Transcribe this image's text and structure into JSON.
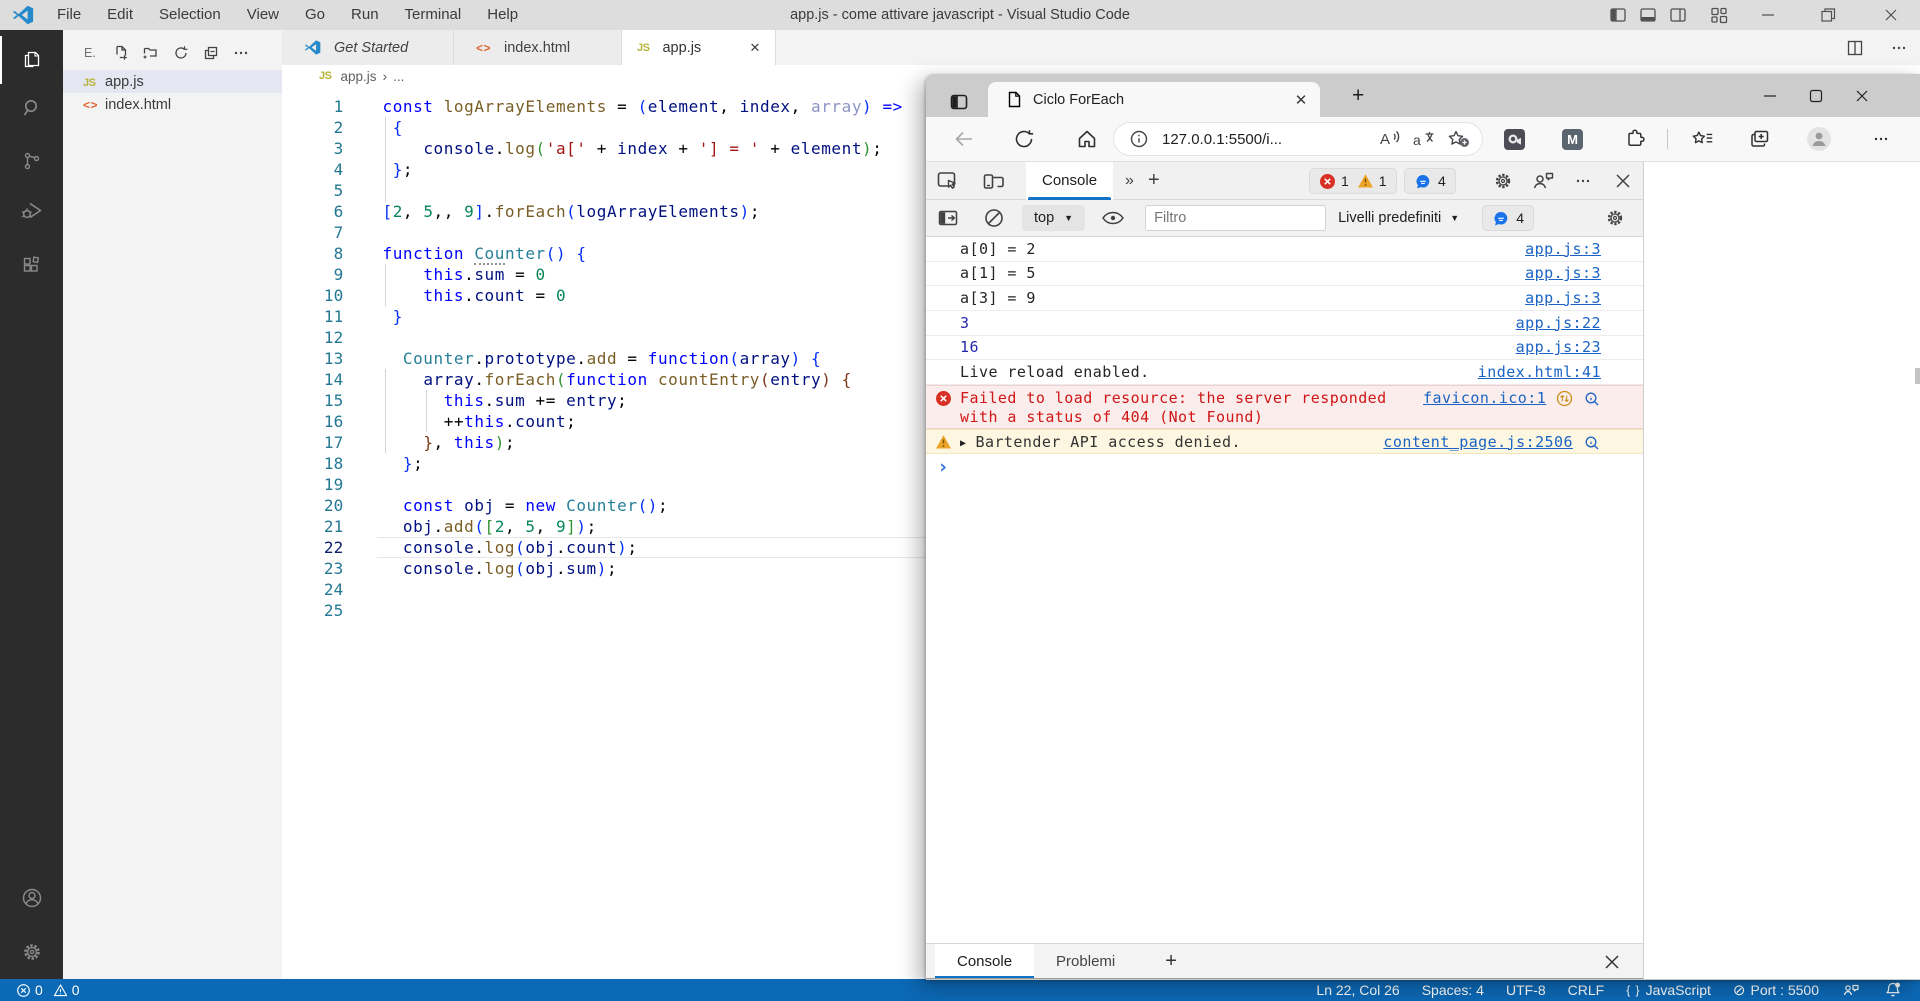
{
  "colors": {
    "vscode_statusbar": "#0c69b6",
    "vscode_activitybar": "#2c2c2c",
    "accent_blue": "#1173c5",
    "error_red": "#d01616",
    "warning_amber": "#eea329",
    "link_blue": "#1a63c5"
  },
  "vscode": {
    "window_title": "app.js - come attivare javascript - Visual Studio Code",
    "menus": [
      "File",
      "Edit",
      "Selection",
      "View",
      "Go",
      "Run",
      "Terminal",
      "Help"
    ],
    "explorer": {
      "header": "E.",
      "files": [
        {
          "name": "app.js",
          "icon": "js",
          "selected": true
        },
        {
          "name": "index.html",
          "icon": "html",
          "selected": false
        }
      ]
    },
    "tabs": [
      {
        "label": "Get Started",
        "icon": "vscode",
        "italic": true,
        "active": false,
        "close": false
      },
      {
        "label": "index.html",
        "icon": "html",
        "italic": false,
        "active": false,
        "close": false
      },
      {
        "label": "app.js",
        "icon": "js",
        "italic": false,
        "active": true,
        "close": true
      }
    ],
    "breadcrumb": {
      "file": "app.js",
      "separator": "›",
      "more": "..."
    },
    "code": {
      "current_line": 22,
      "lines": [
        [
          [
            "kw",
            "const"
          ],
          [
            "pl",
            " "
          ],
          [
            "fn",
            "logArrayElements"
          ],
          [
            "pl",
            " = "
          ],
          [
            "b1",
            "("
          ],
          [
            "vr",
            "element"
          ],
          [
            "pl",
            ", "
          ],
          [
            "vr",
            "index"
          ],
          [
            "pl",
            ", "
          ],
          [
            "fade",
            "array"
          ],
          [
            "b1",
            ")"
          ],
          [
            "pl",
            " "
          ],
          [
            "kw",
            "=>"
          ]
        ],
        [
          [
            "pl",
            " "
          ],
          [
            "b1",
            "{"
          ]
        ],
        [
          [
            "pl",
            "    "
          ],
          [
            "vr",
            "console"
          ],
          [
            "pl",
            "."
          ],
          [
            "fn",
            "log"
          ],
          [
            "b2",
            "("
          ],
          [
            "st",
            "'a['"
          ],
          [
            "pl",
            " + "
          ],
          [
            "vr",
            "index"
          ],
          [
            "pl",
            " + "
          ],
          [
            "st",
            "'] = '"
          ],
          [
            "pl",
            " + "
          ],
          [
            "vr",
            "element"
          ],
          [
            "b2",
            ")"
          ],
          [
            "pl",
            ";"
          ]
        ],
        [
          [
            "pl",
            " "
          ],
          [
            "b1",
            "}"
          ],
          [
            "pl",
            ";"
          ]
        ],
        [],
        [
          [
            "b1",
            "["
          ],
          [
            "nu",
            "2"
          ],
          [
            "pl",
            ", "
          ],
          [
            "nu",
            "5"
          ],
          [
            "pl",
            ",, "
          ],
          [
            "nu",
            "9"
          ],
          [
            "b1",
            "]"
          ],
          [
            "pl",
            "."
          ],
          [
            "fn",
            "forEach"
          ],
          [
            "b1",
            "("
          ],
          [
            "vr",
            "logArrayElements"
          ],
          [
            "b1",
            ")"
          ],
          [
            "pl",
            ";"
          ]
        ],
        [],
        [
          [
            "kw",
            "function"
          ],
          [
            "pl",
            " "
          ],
          [
            "clsh",
            "Cou"
          ],
          [
            "cls",
            "nter"
          ],
          [
            "b1",
            "()"
          ],
          [
            "pl",
            " "
          ],
          [
            "b1",
            "{"
          ]
        ],
        [
          [
            "pl",
            "    "
          ],
          [
            "kw",
            "this"
          ],
          [
            "pl",
            "."
          ],
          [
            "vr",
            "sum"
          ],
          [
            "pl",
            " = "
          ],
          [
            "nu",
            "0"
          ]
        ],
        [
          [
            "pl",
            "    "
          ],
          [
            "kw",
            "this"
          ],
          [
            "pl",
            "."
          ],
          [
            "vr",
            "count"
          ],
          [
            "pl",
            " = "
          ],
          [
            "nu",
            "0"
          ]
        ],
        [
          [
            "pl",
            " "
          ],
          [
            "b1",
            "}"
          ]
        ],
        [],
        [
          [
            "pl",
            "  "
          ],
          [
            "cls",
            "Counter"
          ],
          [
            "pl",
            "."
          ],
          [
            "vr",
            "prototype"
          ],
          [
            "pl",
            "."
          ],
          [
            "fn",
            "add"
          ],
          [
            "pl",
            " = "
          ],
          [
            "kw",
            "function"
          ],
          [
            "b1",
            "("
          ],
          [
            "vr",
            "array"
          ],
          [
            "b1",
            ")"
          ],
          [
            "pl",
            " "
          ],
          [
            "b1",
            "{"
          ]
        ],
        [
          [
            "pl",
            "    "
          ],
          [
            "vr",
            "array"
          ],
          [
            "pl",
            "."
          ],
          [
            "fn",
            "forEach"
          ],
          [
            "b2",
            "("
          ],
          [
            "kw",
            "function"
          ],
          [
            "pl",
            " "
          ],
          [
            "fn",
            "countEntry"
          ],
          [
            "b3",
            "("
          ],
          [
            "vr",
            "entry"
          ],
          [
            "b3",
            ")"
          ],
          [
            "pl",
            " "
          ],
          [
            "b3",
            "{"
          ]
        ],
        [
          [
            "pl",
            "      "
          ],
          [
            "kw",
            "this"
          ],
          [
            "pl",
            "."
          ],
          [
            "vr",
            "sum"
          ],
          [
            "pl",
            " += "
          ],
          [
            "vr",
            "entry"
          ],
          [
            "pl",
            ";"
          ]
        ],
        [
          [
            "pl",
            "      ++"
          ],
          [
            "kw",
            "this"
          ],
          [
            "pl",
            "."
          ],
          [
            "vr",
            "count"
          ],
          [
            "pl",
            ";"
          ]
        ],
        [
          [
            "pl",
            "    "
          ],
          [
            "b3",
            "}"
          ],
          [
            "pl",
            ", "
          ],
          [
            "kw",
            "this"
          ],
          [
            "b2",
            ")"
          ],
          [
            "pl",
            ";"
          ]
        ],
        [
          [
            "pl",
            "  "
          ],
          [
            "b1",
            "}"
          ],
          [
            "pl",
            ";"
          ]
        ],
        [],
        [
          [
            "pl",
            "  "
          ],
          [
            "kw",
            "const"
          ],
          [
            "pl",
            " "
          ],
          [
            "vr",
            "obj"
          ],
          [
            "pl",
            " = "
          ],
          [
            "kw",
            "new"
          ],
          [
            "pl",
            " "
          ],
          [
            "cls",
            "Counter"
          ],
          [
            "b1",
            "()"
          ],
          [
            "pl",
            ";"
          ]
        ],
        [
          [
            "pl",
            "  "
          ],
          [
            "vr",
            "obj"
          ],
          [
            "pl",
            "."
          ],
          [
            "fn",
            "add"
          ],
          [
            "b1",
            "("
          ],
          [
            "b2",
            "["
          ],
          [
            "nu",
            "2"
          ],
          [
            "pl",
            ", "
          ],
          [
            "nu",
            "5"
          ],
          [
            "pl",
            ", "
          ],
          [
            "nu",
            "9"
          ],
          [
            "b2",
            "]"
          ],
          [
            "b1",
            ")"
          ],
          [
            "pl",
            ";"
          ]
        ],
        [
          [
            "pl",
            "  "
          ],
          [
            "vr",
            "console"
          ],
          [
            "pl",
            "."
          ],
          [
            "fn",
            "log"
          ],
          [
            "b1",
            "("
          ],
          [
            "vr",
            "obj"
          ],
          [
            "pl",
            "."
          ],
          [
            "vr",
            "count"
          ],
          [
            "b1",
            ")"
          ],
          [
            "pl",
            ";"
          ]
        ],
        [
          [
            "pl",
            "  "
          ],
          [
            "vr",
            "console"
          ],
          [
            "pl",
            "."
          ],
          [
            "fn",
            "log"
          ],
          [
            "b1",
            "("
          ],
          [
            "vr",
            "obj"
          ],
          [
            "pl",
            "."
          ],
          [
            "vr",
            "sum"
          ],
          [
            "b1",
            ")"
          ],
          [
            "pl",
            ";"
          ]
        ],
        [],
        []
      ],
      "indent_guides": [
        {
          "ch": 0,
          "from_line": 2,
          "to_line": 5
        },
        {
          "ch": 0,
          "from_line": 9,
          "to_line": 10
        },
        {
          "ch": 0,
          "from_line": 14,
          "to_line": 17
        },
        {
          "ch": 4,
          "from_line": 15,
          "to_line": 16
        }
      ]
    },
    "statusbar": {
      "errors": "0",
      "warnings": "0",
      "line_col": "Ln 22, Col 26",
      "spaces": "Spaces: 4",
      "encoding": "UTF-8",
      "eol": "CRLF",
      "braces": "{ }",
      "language": "JavaScript",
      "port": "Port : 5500"
    }
  },
  "edge": {
    "tab_title": "Ciclo ForEach",
    "url": "127.0.0.1:5500/i...",
    "devtools": {
      "console_tab": "Console",
      "more_tabs": "»",
      "add_tab": "+",
      "badge_errors": "1",
      "badge_warnings": "1",
      "badge_messages": "4",
      "context_label": "top",
      "filter_placeholder": "Filtro",
      "levels_label": "Livelli predefiniti",
      "toolbar_messages": "4",
      "messages": [
        {
          "type": "log",
          "text": "a[0] = 2",
          "link": "app.js:3"
        },
        {
          "type": "log",
          "text": "a[1] = 5",
          "link": "app.js:3"
        },
        {
          "type": "log",
          "text": "a[3] = 9",
          "link": "app.js:3"
        },
        {
          "type": "result",
          "text": "3",
          "link": "app.js:22"
        },
        {
          "type": "result",
          "text": "16",
          "link": "app.js:23"
        },
        {
          "type": "log",
          "text": "Live reload enabled.",
          "link": "index.html:41"
        },
        {
          "type": "error",
          "text": "Failed to load resource: the server responded with a status of 404 (Not Found)",
          "link": "favicon.ico:1",
          "extra": true
        },
        {
          "type": "warning",
          "text": "Bartender API access denied.",
          "link": "content_page.js:2506",
          "expandable": true
        }
      ],
      "drawer_tabs": [
        {
          "label": "Console",
          "active": true
        },
        {
          "label": "Problemi",
          "active": false
        }
      ]
    }
  }
}
